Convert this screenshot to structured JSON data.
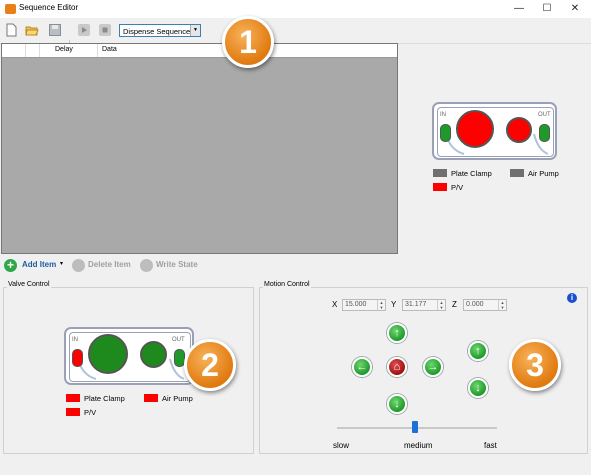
{
  "window": {
    "title": "Sequence Editor",
    "minimize": "—",
    "maximize": "☐",
    "close": "✕"
  },
  "toolbar": {
    "sequence_selected": "Dispense Sequence"
  },
  "callouts": [
    "1",
    "2",
    "3"
  ],
  "grid": {
    "columns": [
      "Delay",
      "Data"
    ]
  },
  "preview_valve": {
    "in_label": "IN",
    "out_label": "OUT",
    "legend": [
      {
        "label": "Plate Clamp",
        "color": "#707070"
      },
      {
        "label": "Air Pump",
        "color": "#707070"
      },
      {
        "label": "P/V",
        "color": "#ff0000"
      }
    ]
  },
  "actions": {
    "add_item": "Add Item",
    "delete_item": "Delete Item",
    "write_state": "Write State"
  },
  "valve_control": {
    "title": "Valve Control",
    "in_label": "IN",
    "out_label": "OUT",
    "legend": [
      {
        "label": "Plate Clamp",
        "color": "#ff0000"
      },
      {
        "label": "Air Pump",
        "color": "#ff0000"
      },
      {
        "label": "P/V",
        "color": "#ff0000"
      }
    ]
  },
  "motion_control": {
    "title": "Motion Control",
    "x_label": "X",
    "x_value": "15.000",
    "y_label": "Y",
    "y_value": "31.177",
    "z_label": "Z",
    "z_value": "0.000",
    "speed_labels": {
      "slow": "slow",
      "medium": "medium",
      "fast": "fast"
    },
    "speed_level": 0.5
  },
  "colors": {
    "accent": "#3c7fb1",
    "active_red": "#ff0000",
    "inactive_green": "#1e9a2a",
    "callout_orange": "#e07a10"
  }
}
